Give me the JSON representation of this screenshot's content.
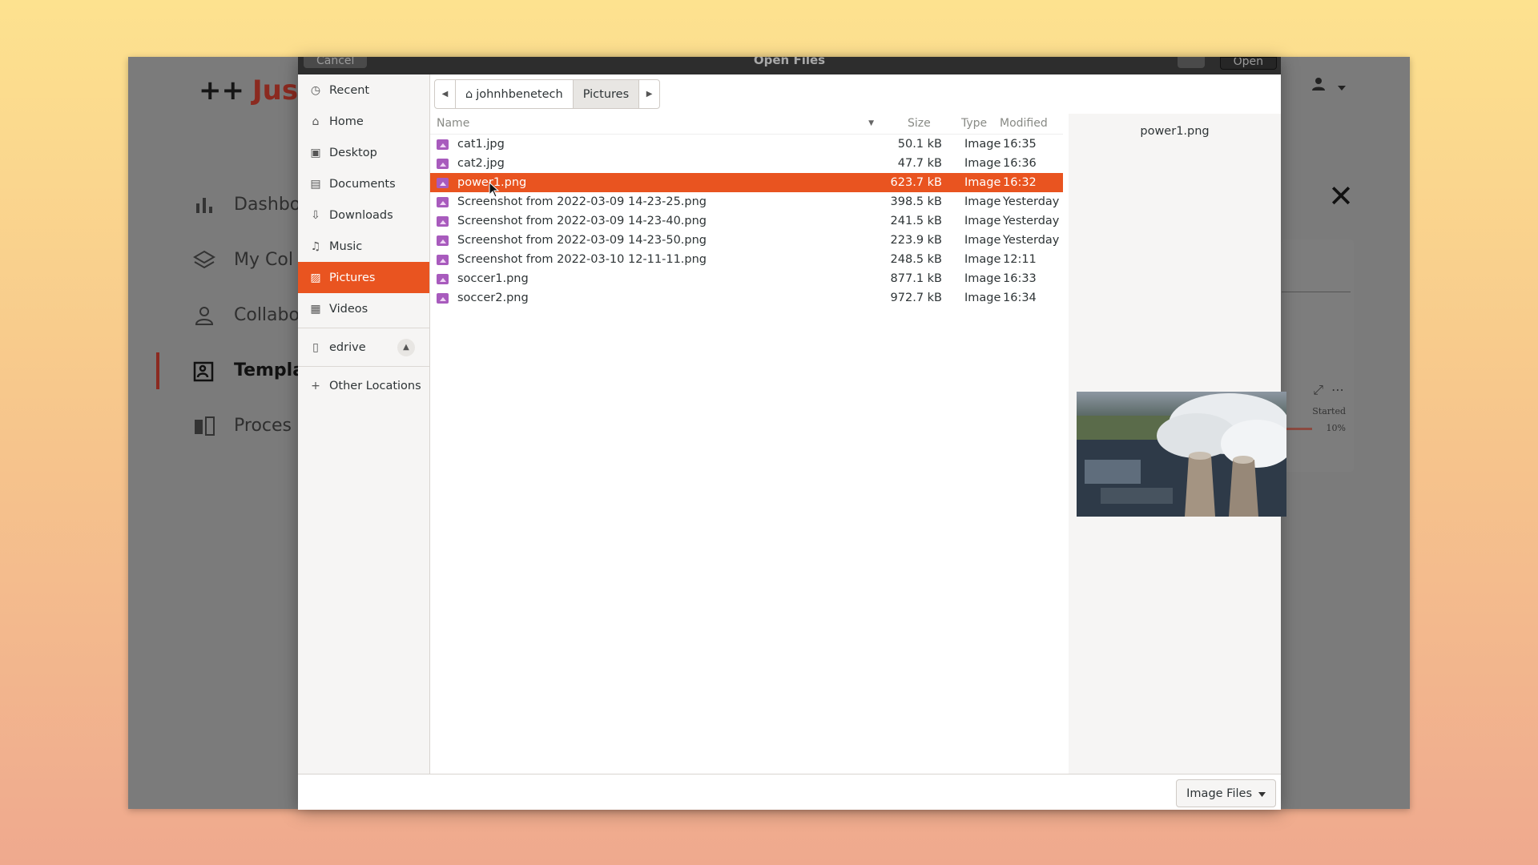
{
  "app": {
    "logo_plus": "++",
    "logo_name": "Justi",
    "nav": [
      {
        "label": "Dashbo",
        "icon": "bar-chart-icon"
      },
      {
        "label": "My Col",
        "icon": "layers-icon"
      },
      {
        "label": "Collabo",
        "icon": "person-icon"
      },
      {
        "label": "Templa",
        "icon": "template-icon",
        "active": true
      },
      {
        "label": "Proces",
        "icon": "process-icon"
      }
    ],
    "card": {
      "status": "Started",
      "progress_label": "10%",
      "progress": 0.1
    }
  },
  "dialog": {
    "title": "Open Files",
    "cancel_label": "Cancel",
    "open_label": "Open",
    "sidebar": {
      "places": [
        {
          "label": "Recent",
          "icon": "clock-icon"
        },
        {
          "label": "Home",
          "icon": "home-icon"
        },
        {
          "label": "Desktop",
          "icon": "desktop-icon"
        },
        {
          "label": "Documents",
          "icon": "documents-icon"
        },
        {
          "label": "Downloads",
          "icon": "download-icon"
        },
        {
          "label": "Music",
          "icon": "music-icon"
        },
        {
          "label": "Pictures",
          "icon": "pictures-icon",
          "active": true
        },
        {
          "label": "Videos",
          "icon": "videos-icon"
        }
      ],
      "drive": {
        "label": "edrive",
        "icon": "drive-icon"
      },
      "other": {
        "label": "Other Locations",
        "icon": "plus-icon"
      }
    },
    "path": {
      "home": "johnhbenetech",
      "current": "Pictures"
    },
    "columns": {
      "name": "Name",
      "size": "Size",
      "type": "Type",
      "modified": "Modified"
    },
    "files": [
      {
        "name": "cat1.jpg",
        "size": "50.1 kB",
        "type": "Image",
        "modified": "16:35"
      },
      {
        "name": "cat2.jpg",
        "size": "47.7 kB",
        "type": "Image",
        "modified": "16:36"
      },
      {
        "name": "power1.png",
        "size": "623.7 kB",
        "type": "Image",
        "modified": "16:32",
        "selected": true
      },
      {
        "name": "Screenshot from 2022-03-09 14-23-25.png",
        "size": "398.5 kB",
        "type": "Image",
        "modified": "Yesterday"
      },
      {
        "name": "Screenshot from 2022-03-09 14-23-40.png",
        "size": "241.5 kB",
        "type": "Image",
        "modified": "Yesterday"
      },
      {
        "name": "Screenshot from 2022-03-09 14-23-50.png",
        "size": "223.9 kB",
        "type": "Image",
        "modified": "Yesterday"
      },
      {
        "name": "Screenshot from 2022-03-10 12-11-11.png",
        "size": "248.5 kB",
        "type": "Image",
        "modified": "12:11"
      },
      {
        "name": "soccer1.png",
        "size": "877.1 kB",
        "type": "Image",
        "modified": "16:33"
      },
      {
        "name": "soccer2.png",
        "size": "972.7 kB",
        "type": "Image",
        "modified": "16:34"
      }
    ],
    "preview": {
      "name": "power1.png"
    },
    "filter": {
      "label": "Image Files"
    }
  },
  "colors": {
    "accent": "#e95420",
    "brand": "#8b2a20"
  }
}
